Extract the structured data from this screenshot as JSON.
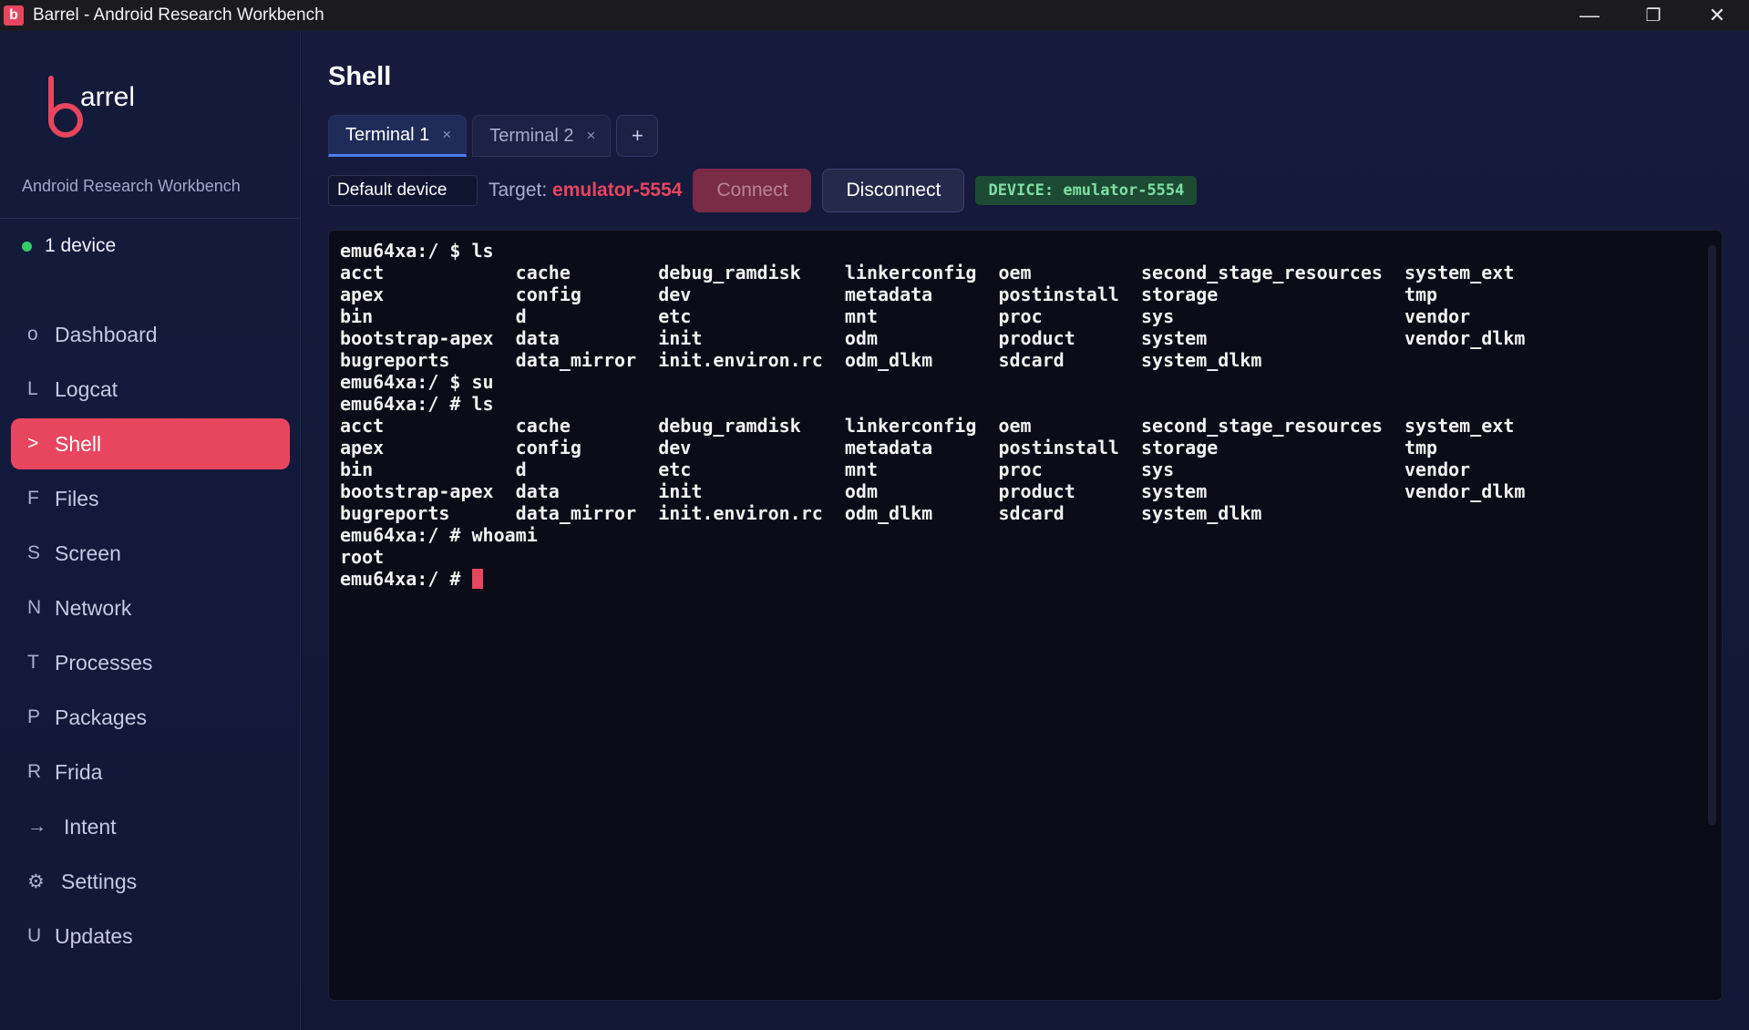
{
  "window": {
    "icon_letter": "b",
    "title": "Barrel - Android Research Workbench",
    "controls": {
      "minimize": "—",
      "restore": "❐",
      "close": "✕"
    }
  },
  "sidebar": {
    "logo_text": "arrel",
    "subtitle": "Android Research Workbench",
    "device_status": "1 device",
    "status_color": "#35c96a",
    "items": [
      {
        "glyph": "o",
        "label": "Dashboard"
      },
      {
        "glyph": "L",
        "label": "Logcat"
      },
      {
        "glyph": ">",
        "label": "Shell"
      },
      {
        "glyph": "F",
        "label": "Files"
      },
      {
        "glyph": "S",
        "label": "Screen"
      },
      {
        "glyph": "N",
        "label": "Network"
      },
      {
        "glyph": "T",
        "label": "Processes"
      },
      {
        "glyph": "P",
        "label": "Packages"
      },
      {
        "glyph": "R",
        "label": "Frida"
      },
      {
        "glyph": "→",
        "label": "Intent"
      },
      {
        "glyph": "⚙",
        "label": "Settings"
      },
      {
        "glyph": "U",
        "label": "Updates"
      }
    ],
    "active_item": "Shell"
  },
  "main": {
    "title": "Shell",
    "tabs": [
      {
        "label": "Terminal 1",
        "close": "×"
      },
      {
        "label": "Terminal 2",
        "close": "×"
      }
    ],
    "add_tab": "+",
    "device_select": "Default device",
    "target_label": "Target:",
    "target_value": "emulator-5554",
    "connect_label": "Connect",
    "disconnect_label": "Disconnect",
    "device_badge": "DEVICE: emulator-5554",
    "accent_color": "#e8455f"
  },
  "terminal": {
    "lines": [
      "emu64xa:/ $ ls",
      "acct            cache        debug_ramdisk    linkerconfig  oem          second_stage_resources  system_ext",
      "apex            config       dev              metadata      postinstall  storage                 tmp",
      "bin             d            etc              mnt           proc         sys                     vendor",
      "bootstrap-apex  data         init             odm           product      system                  vendor_dlkm",
      "bugreports      data_mirror  init.environ.rc  odm_dlkm      sdcard       system_dlkm",
      "emu64xa:/ $ su",
      "emu64xa:/ # ls",
      "acct            cache        debug_ramdisk    linkerconfig  oem          second_stage_resources  system_ext",
      "apex            config       dev              metadata      postinstall  storage                 tmp",
      "bin             d            etc              mnt           proc         sys                     vendor",
      "bootstrap-apex  data         init             odm           product      system                  vendor_dlkm",
      "bugreports      data_mirror  init.environ.rc  odm_dlkm      sdcard       system_dlkm",
      "emu64xa:/ # whoami",
      "root"
    ],
    "prompt": "emu64xa:/ # "
  }
}
